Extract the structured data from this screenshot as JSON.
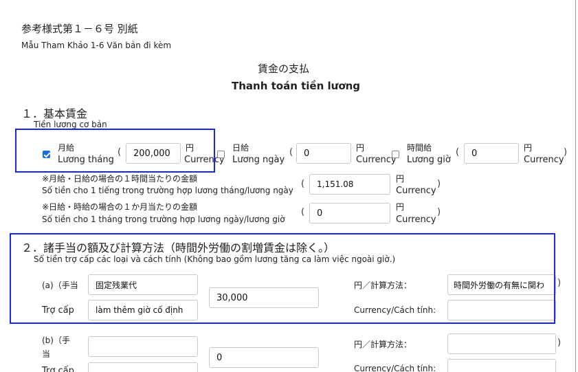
{
  "header": {
    "form_no_jp": "参考様式第１－６号 別紙",
    "form_no_vi": "Mẫu Tham Khảo 1-6 Văn bản đi kèm",
    "title_jp": "賃金の支払",
    "title_vi": "Thanh toán tiền lương"
  },
  "section1": {
    "heading_jp": "１．基本賃金",
    "heading_vi": "Tiền lương cơ bản",
    "monthly": {
      "checked": true,
      "label_jp": "月給",
      "label_vi": "Lương tháng",
      "value": "200,000",
      "unit_jp": "円",
      "unit_vi": "Currency"
    },
    "daily": {
      "checked": false,
      "label_jp": "日給",
      "label_vi": "Lương ngày",
      "value": "0",
      "unit_jp": "円",
      "unit_vi": "Currency"
    },
    "hourly": {
      "checked": false,
      "label_jp": "時間給",
      "label_vi": "Lương giờ",
      "value": "0",
      "unit_jp": "円",
      "unit_vi": "Currency"
    },
    "hourly_equiv": {
      "note_jp": "※月給・日給の場合の１時間当たりの金額",
      "note_vi": "Số tiền cho 1 tiếng trong trường hợp lương tháng/lương ngày",
      "value": "1,151.08",
      "unit_jp": "円",
      "unit_vi": "Currency"
    },
    "monthly_equiv": {
      "note_jp": "※日給・時給の場合の１か月当たりの金額",
      "note_vi": "Số tiền cho 1 tháng trong trường hợp lương ngày/lương giờ",
      "value": "0",
      "unit_jp": "円",
      "unit_vi": "Currency"
    }
  },
  "section2": {
    "heading_jp": "２．諸手当の額及び計算方法（時間外労働の割増賃金は除く。）",
    "heading_vi": "Số tiền trợ cấp các loại và cách tính (Không bao gồm lương tăng ca làm việc ngoài giờ.)",
    "allowances": [
      {
        "label_jp": "(a)（手当",
        "label_vi": "Trợ cấp",
        "name_jp": "固定残業代",
        "name_vi": "làm thêm giờ cố định",
        "amount": "30,000",
        "unit_label_jp": "円／計算方法：",
        "unit_label_vi": "Currency/Cách tính:",
        "method_jp": "時間外労働の有無に関わ",
        "method_vi": ""
      },
      {
        "label_jp": "(b)（手",
        "label_jp2": "当",
        "label_vi": "Trợ cấp",
        "name_jp": "",
        "name_vi": "",
        "amount": "0",
        "unit_label_jp": "円／計算方法：",
        "unit_label_vi": "Currency/Cách tính:",
        "method_jp": "",
        "method_vi": ""
      }
    ]
  },
  "colors": {
    "highlight": "#1428e6",
    "checkbox": "#1a6fe0"
  }
}
